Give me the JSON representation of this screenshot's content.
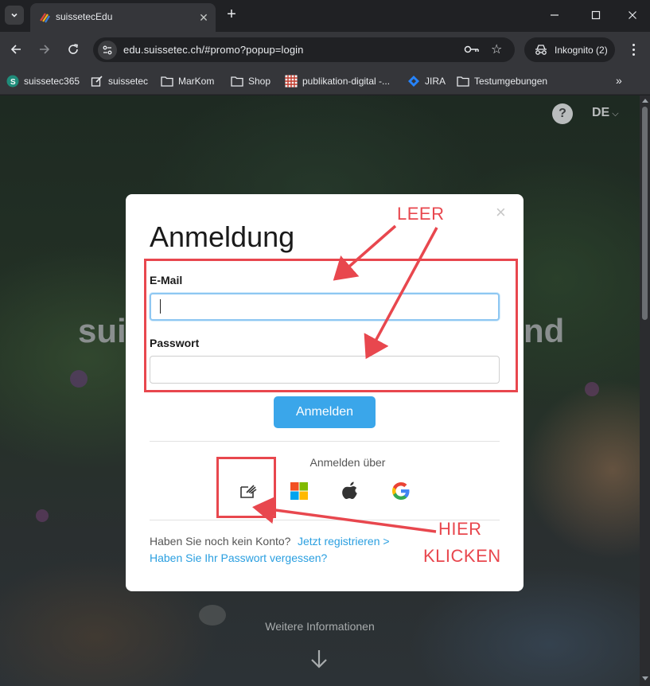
{
  "browser": {
    "tab_title": "suissetecEdu",
    "url": "edu.suissetec.ch/#promo?popup=login",
    "profile_label": "Inkognito (2)",
    "bookmarks": [
      {
        "label": "suissetec365",
        "icon": "s-logo-icon"
      },
      {
        "label": "suissetec",
        "icon": "edit-page-icon"
      },
      {
        "label": "MarKom",
        "icon": "folder-icon"
      },
      {
        "label": "Shop",
        "icon": "folder-icon"
      },
      {
        "label": "publikation-digital -...",
        "icon": "grid-favicon-icon"
      },
      {
        "label": "JIRA",
        "icon": "jira-icon"
      },
      {
        "label": "Testumgebungen",
        "icon": "folder-icon"
      }
    ],
    "bookmarks_more": "»"
  },
  "page": {
    "help": "?",
    "language": "DE",
    "hero_left": "sui",
    "hero_right": "nd",
    "more_info": "Weitere Informationen"
  },
  "modal": {
    "title": "Anmeldung",
    "close": "×",
    "email_label": "E-Mail",
    "email_value": "",
    "password_label": "Passwort",
    "password_value": "",
    "submit_label": "Anmelden",
    "via_label": "Anmelden über",
    "sso_providers": [
      "edu-id",
      "microsoft",
      "apple",
      "google"
    ],
    "no_account_text": "Haben Sie noch kein Konto?",
    "register_link": "Jetzt registrieren >",
    "forgot_link": "Haben Sie Ihr Passwort vergessen?"
  },
  "annotations": {
    "leer": "LEER",
    "hier": "HIER",
    "klicken": "KLICKEN",
    "color": "#e8474e"
  }
}
